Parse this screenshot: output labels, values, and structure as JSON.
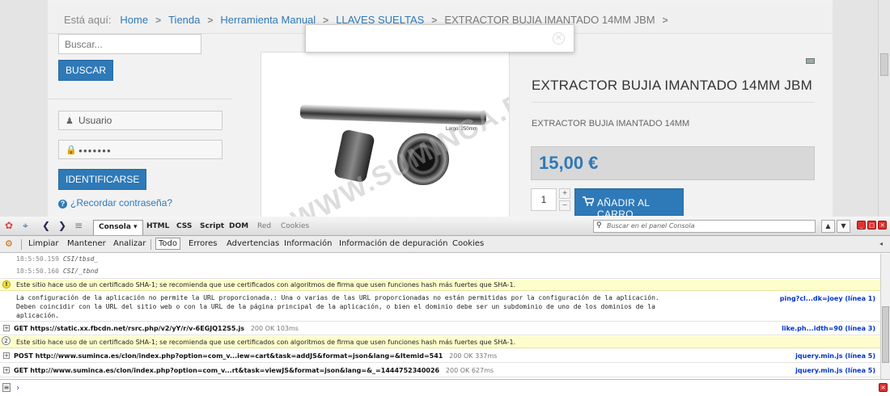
{
  "breadcrumb": {
    "prefix": "Está aquí:",
    "items": [
      "Home",
      "Tienda",
      "Herramienta Manual",
      "LLAVES SUELTAS",
      "EXTRACTOR BUJIA IMANTADO 14MM JBM"
    ]
  },
  "sidebar": {
    "search_placeholder": "Buscar...",
    "search_button": "BUSCAR",
    "username_value": "Usuario",
    "password_value": "●●●●●●●",
    "login_button": "IDENTIFICARSE",
    "forgot_password": "¿Recordar contraseña?"
  },
  "product": {
    "title": "EXTRACTOR BUJIA IMANTADO 14MM JBM",
    "description": "EXTRACTOR BUJIA IMANTADO 14MM",
    "price": "15,00 €",
    "quantity": "1",
    "add_to_cart": "AÑADIR AL CARRO",
    "image_label": "Largo: 250mm",
    "watermark": "WWW.SUMINCA.ES"
  },
  "firebug": {
    "tabs": [
      "Consola",
      "HTML",
      "CSS",
      "Script",
      "DOM",
      "Red",
      "Cookies"
    ],
    "active_tab": "Consola ▾",
    "search_placeholder": "Buscar en el panel Consola",
    "toolbar": [
      "Limpiar",
      "Mantener",
      "Analizar",
      "Todo",
      "Errores",
      "Advertencias",
      "Información",
      "Información de depuración",
      "Cookies"
    ],
    "log": {
      "line1_time": "18:5:50.159",
      "line1_text": "CSI/tbsd_",
      "line2_time": "18:5:50.160",
      "line2_text": "CSI/_tbnd",
      "warn1": "Este sitio hace uso de un certificado SHA-1; se recomienda que use certificados con algoritmos de firma que usen funciones hash más fuertes que SHA-1.",
      "error_l1": "La configuración de la aplicación no permite la URL proporcionada.: Una o varias de las URL proporcionadas no están permitidas por la configuración de la aplicación.",
      "error_l2": "Deben coincidir con la URL del sitio web o con la URL de la página principal de la aplicación, o bien el dominio debe ser un subdominio de uno de los dominios de la",
      "error_l3": "aplicación.",
      "error_src": "ping?cl...dk=joey (línea 1)",
      "net1": "GET https://static.xx.fbcdn.net/rsrc.php/v2/yY/r/v-6EGJQ12S5.js",
      "net1_status": "200 OK 103ms",
      "net1_src": "like.ph...idth=90 (línea 3)",
      "warn2_count": "2",
      "warn2": "Este sitio hace uso de un certificado SHA-1; se recomienda que use certificados con algoritmos de firma que usen funciones hash más fuertes que SHA-1.",
      "net2": "POST http://www.suminca.es/clon/index.php?option=com_v...iew=cart&task=addJS&format=json&lang=&Itemid=541",
      "net2_status": "200 OK 337ms",
      "net2_src": "jquery.min.js (línea 5)",
      "net3": "GET http://www.suminca.es/clon/index.php?option=com_v...rt&task=viewJS&format=json&lang=&_=1444752340026",
      "net3_status": "200 OK 627ms",
      "net3_src": "jquery.min.js (línea 5)"
    },
    "prompt": "›"
  }
}
